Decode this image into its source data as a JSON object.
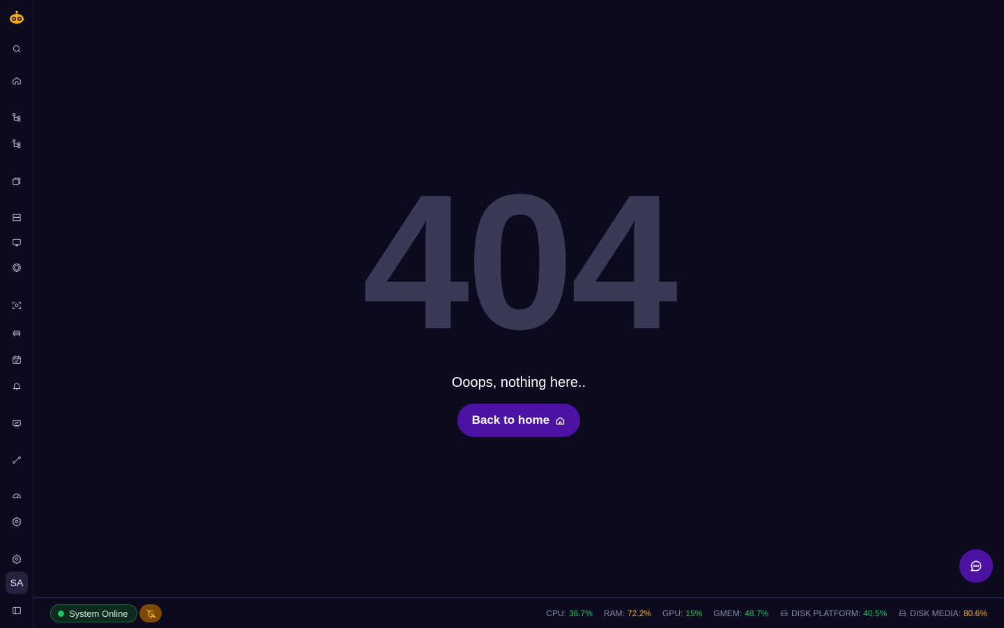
{
  "sidebar": {
    "avatar_initials": "SA",
    "items": [
      {
        "icon": "search-icon"
      },
      {
        "icon": "home-icon"
      },
      {
        "icon": "tree-icon"
      },
      {
        "icon": "tree-icon"
      },
      {
        "icon": "copy-icon"
      },
      {
        "icon": "server-icon"
      },
      {
        "icon": "cast-icon"
      },
      {
        "icon": "circle-icon"
      },
      {
        "icon": "scan-icon"
      },
      {
        "icon": "car-icon"
      },
      {
        "icon": "calendar-check-icon"
      },
      {
        "icon": "bell-icon"
      },
      {
        "icon": "presentation-icon"
      },
      {
        "icon": "route-icon"
      },
      {
        "icon": "gauge-icon"
      },
      {
        "icon": "settings-icon"
      },
      {
        "icon": "settings-icon"
      },
      {
        "icon": "sidebar-toggle-icon"
      }
    ]
  },
  "main": {
    "code": "404",
    "message": "Ooops, nothing here..",
    "button_label": "Back to home"
  },
  "status": {
    "online_label": "System Online",
    "stats": [
      {
        "label": "CPU:",
        "value": "36.7%",
        "color": "#22c55e"
      },
      {
        "label": "RAM:",
        "value": "72.2%",
        "color": "#f5b42a"
      },
      {
        "label": "GPU:",
        "value": "15%",
        "color": "#22c55e"
      },
      {
        "label": "GMEM:",
        "value": "48.7%",
        "color": "#22c55e"
      },
      {
        "label": "DISK PLATFORM:",
        "value": "40.5%",
        "color": "#22c55e",
        "icon": "disk-icon"
      },
      {
        "label": "DISK MEDIA:",
        "value": "80.6%",
        "color": "#f5b42a",
        "icon": "disk-icon"
      }
    ]
  },
  "colors": {
    "background": "#0c0a1f",
    "accent": "#4c12a1",
    "ok": "#22c55e",
    "warn": "#f5b42a"
  }
}
